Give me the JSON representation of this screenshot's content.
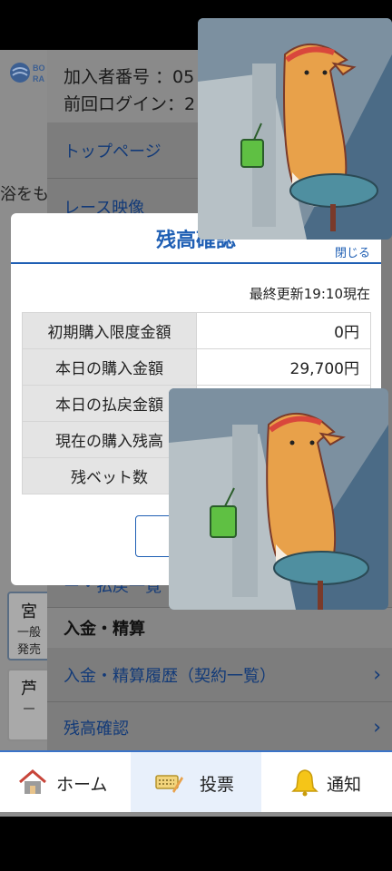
{
  "background": {
    "logo_text": "BO RA",
    "side_text": "浴をも",
    "card_1": {
      "title": "宮",
      "lines": [
        "一般",
        "発売"
      ]
    },
    "card_2": {
      "title": "芦",
      "lines": [
        "一"
      ]
    }
  },
  "menu": {
    "member_number": "加入者番号 ：05",
    "last_login": "前回ログイン：2",
    "items": [
      {
        "label": "トップページ"
      },
      {
        "label": "レース映像"
      }
    ],
    "partial_item": "ー・払戻一覧",
    "section_label": "入金・精算",
    "section_items": [
      {
        "label": "入金・精算履歴（契約一覧）",
        "chevron": "›"
      },
      {
        "label": "残高確認",
        "chevron": "›"
      }
    ]
  },
  "dialog": {
    "title": "残高確認",
    "close_label": "閉じる",
    "updated": "最終更新19:10現在",
    "rows": [
      {
        "label": "初期購入限度金額",
        "value": "0円"
      },
      {
        "label": "本日の購入金額",
        "value": "29,700円"
      },
      {
        "label": "本日の払戻金額",
        "value": ""
      },
      {
        "label": "現在の購入残高",
        "value": ""
      },
      {
        "label": "残ベット数",
        "value": ""
      }
    ],
    "button_label": ""
  },
  "bottom_nav": {
    "tabs": [
      {
        "label": "ホーム",
        "icon": "home-icon"
      },
      {
        "label": "投票",
        "icon": "ticket-icon"
      },
      {
        "label": "通知",
        "icon": "bell-icon"
      }
    ]
  },
  "colors": {
    "accent": "#1f5fb4",
    "sticker_orange": "#e8a14a",
    "sticker_bg": "#4b6b86"
  }
}
